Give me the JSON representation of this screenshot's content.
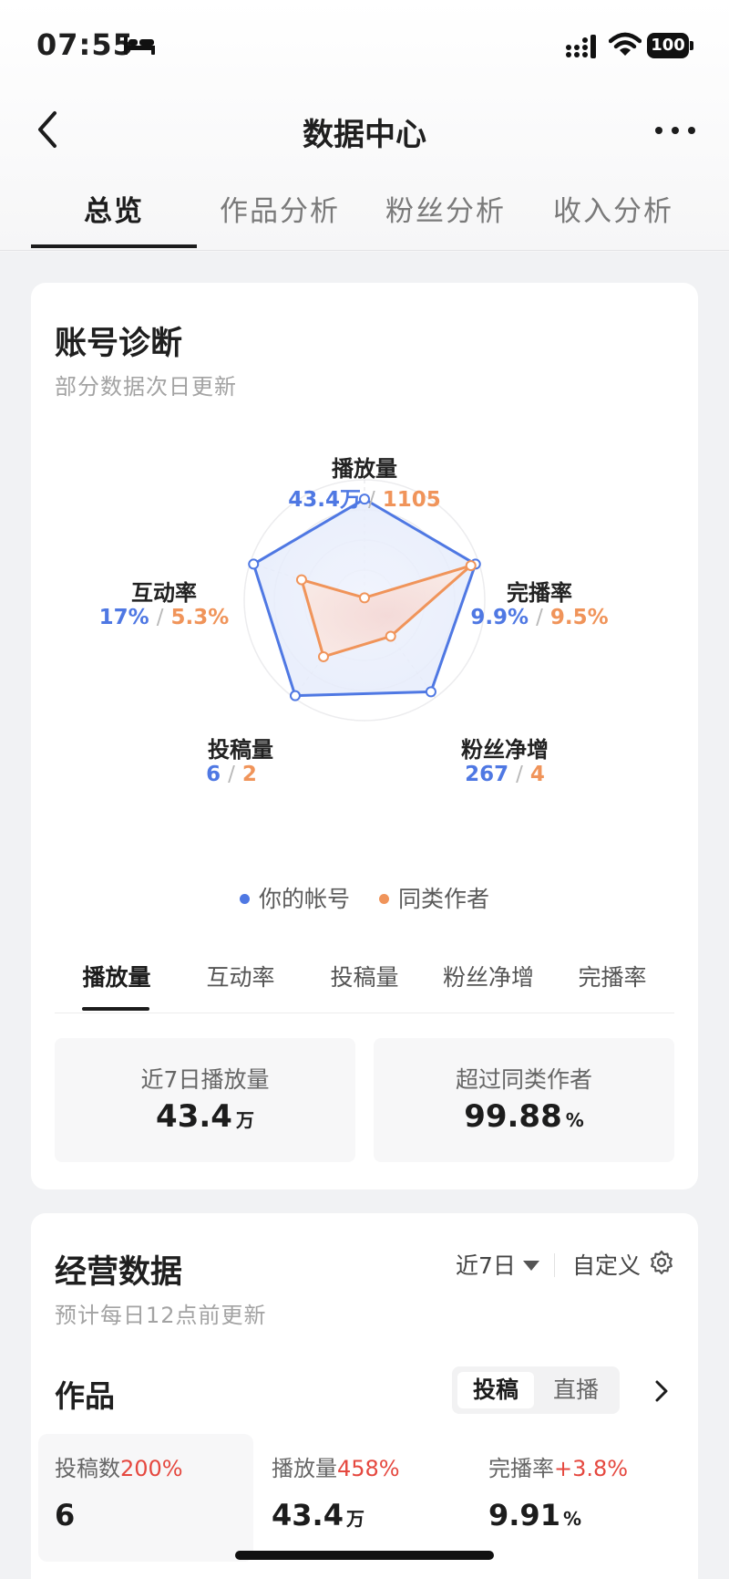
{
  "status_bar": {
    "time": "07:55",
    "battery": "100"
  },
  "nav": {
    "title": "数据中心"
  },
  "top_tabs": [
    "总览",
    "作品分析",
    "粉丝分析",
    "收入分析"
  ],
  "diagnosis": {
    "title": "账号诊断",
    "subtitle": "部分数据次日更新",
    "radar_axes": [
      {
        "label": "播放量",
        "mine": "43.4万",
        "peer": "1105",
        "mine_level": 0.84,
        "peer_level": 0.02
      },
      {
        "label": "完播率",
        "mine": "9.9%",
        "peer": "9.5%",
        "mine_level": 0.97,
        "peer_level": 0.93
      },
      {
        "label": "粉丝净增",
        "mine": "267",
        "peer": "4",
        "mine_level": 0.94,
        "peer_level": 0.37
      },
      {
        "label": "投稿量",
        "mine": "6",
        "peer": "2",
        "mine_level": 0.98,
        "peer_level": 0.58
      },
      {
        "label": "互动率",
        "mine": "17%",
        "peer": "5.3%",
        "mine_level": 0.97,
        "peer_level": 0.55
      }
    ],
    "separator": "/",
    "legend": {
      "mine": "你的帐号",
      "peer": "同类作者"
    },
    "colors": {
      "mine": "#4f78e3",
      "peer": "#f0945a"
    },
    "metric_tabs": [
      "播放量",
      "互动率",
      "投稿量",
      "粉丝净增",
      "完播率"
    ],
    "stat_left": {
      "label": "近7日播放量",
      "value": "43.4",
      "unit": "万"
    },
    "stat_right": {
      "label": "超过同类作者",
      "value": "99.88",
      "unit": "%"
    }
  },
  "business": {
    "title": "经营数据",
    "subtitle": "预计每日12点前更新",
    "period": "近7日",
    "custom": "自定义",
    "section": "作品",
    "segments": [
      "投稿",
      "直播"
    ],
    "kpis": [
      {
        "label": "投稿数",
        "change": "200%",
        "value": "6",
        "unit": ""
      },
      {
        "label": "播放量",
        "change": "458%",
        "value": "43.4",
        "unit": "万"
      },
      {
        "label": "完播率",
        "change": "+3.8%",
        "value": "9.91",
        "unit": "%"
      }
    ]
  }
}
